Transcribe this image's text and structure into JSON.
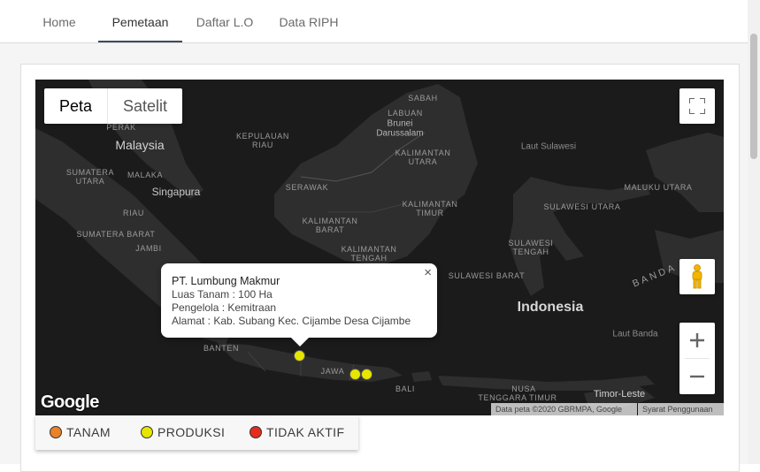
{
  "nav": {
    "tabs": [
      {
        "label": "Home",
        "active": false
      },
      {
        "label": "Pemetaan",
        "active": true
      },
      {
        "label": "Daftar L.O",
        "active": false
      },
      {
        "label": "Data RIPH",
        "active": false
      }
    ]
  },
  "map": {
    "type_control": {
      "map_label": "Peta",
      "satellite_label": "Satelit",
      "selected": "Peta"
    },
    "labels": {
      "sabah": "SABAH",
      "perak": "PERAK",
      "labuan": "LABUAN",
      "brunei": "Brunei",
      "darussalam": "Darussalam",
      "malaysia": "Malaysia",
      "kepulauan_riau_1": "KEPULAUAN",
      "kepulauan_riau_2": "RIAU",
      "kaltara_1": "KALIMANTAN",
      "kaltara_2": "UTARA",
      "laut_sulawesi": "Laut Sulawesi",
      "sumut_1": "SUMATERA",
      "sumut_2": "UTARA",
      "malaka": "MALAKA",
      "singapura": "Singapura",
      "serawak": "SERAWAK",
      "riau": "RIAU",
      "kaltim_1": "KALIMANTAN",
      "kaltim_2": "TIMUR",
      "maluku_utara": "MALUKU UTARA",
      "sulut": "SULAWESI UTARA",
      "kalbar_1": "KALIMANTAN",
      "kalbar_2": "BARAT",
      "sumbar": "SUMATERA BARAT",
      "jambi": "JAMBI",
      "kalteng_1": "KALIMANTAN",
      "kalteng_2": "TENGAH",
      "sulteng_1": "SULAWESI",
      "sulteng_2": "TENGAH",
      "banda": "BANDA",
      "sulbar": "SULAWESI BARAT",
      "indonesia": "Indonesia",
      "laut_banda": "Laut Banda",
      "banten": "BANTEN",
      "jawa": "JAWA",
      "bali": "BALI",
      "ntb_1": "NUSA",
      "ntb_2": "TENGGARA TIMUR",
      "timor_leste": "Timor-Leste"
    },
    "infowindow": {
      "company": "PT. Lumbung Makmur",
      "luas_tanam": "Luas Tanam : 100 Ha",
      "pengelola": "Pengelola : Kemitraan",
      "alamat": "Alamat : Kab. Subang Kec. Cijambe Desa Cijambe",
      "close_glyph": "×"
    },
    "markers": [
      {
        "status": "PRODUKSI",
        "color": "#e6e600"
      },
      {
        "status": "PRODUKSI",
        "color": "#e6e600"
      },
      {
        "status": "PRODUKSI",
        "color": "#e6e600"
      }
    ],
    "logo_text": "Google",
    "attribution": "Data peta ©2020 GBRMPA, Google",
    "terms": "Syarat Penggunaan",
    "icons": [
      "fullscreen-icon",
      "pegman-icon",
      "zoom-in-icon",
      "zoom-out-icon"
    ]
  },
  "legend": [
    {
      "label": "TANAM",
      "color": "#e8832a"
    },
    {
      "label": "PRODUKSI",
      "color": "#e6e600"
    },
    {
      "label": "TIDAK AKTIF",
      "color": "#e52b1f"
    }
  ]
}
